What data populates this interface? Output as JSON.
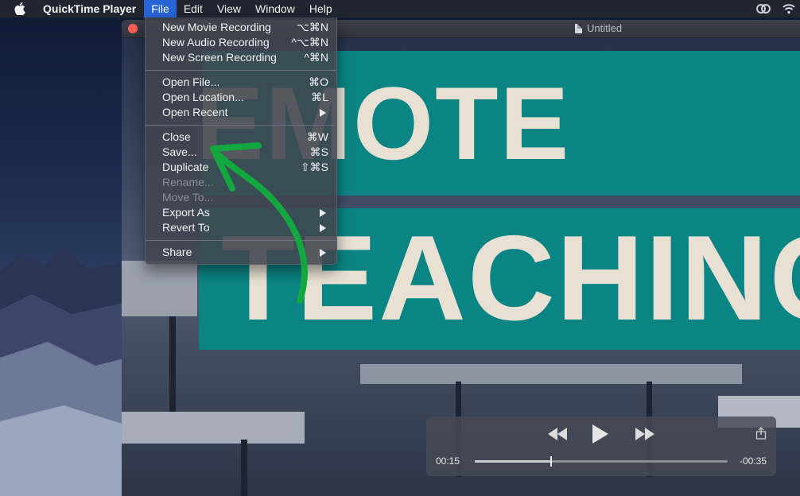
{
  "menubar": {
    "app_name": "QuickTime Player",
    "menus": [
      "File",
      "Edit",
      "View",
      "Window",
      "Help"
    ],
    "active_menu": "File"
  },
  "window": {
    "title": "Untitled"
  },
  "video": {
    "line1": "EMOTE",
    "line2": "TEACHING"
  },
  "file_menu": {
    "items": [
      {
        "label": "New Movie Recording",
        "shortcut": "⌥⌘N"
      },
      {
        "label": "New Audio Recording",
        "shortcut": "^⌥⌘N"
      },
      {
        "label": "New Screen Recording",
        "shortcut": "^⌘N"
      },
      {
        "label": "Open File...",
        "shortcut": "⌘O"
      },
      {
        "label": "Open Location...",
        "shortcut": "⌘L"
      },
      {
        "label": "Open Recent",
        "shortcut": ""
      },
      {
        "label": "Close",
        "shortcut": "⌘W"
      },
      {
        "label": "Save...",
        "shortcut": "⌘S"
      },
      {
        "label": "Duplicate",
        "shortcut": "⇧⌘S"
      },
      {
        "label": "Rename...",
        "shortcut": ""
      },
      {
        "label": "Move To...",
        "shortcut": ""
      },
      {
        "label": "Export As",
        "shortcut": ""
      },
      {
        "label": "Revert To",
        "shortcut": ""
      },
      {
        "label": "Share",
        "shortcut": ""
      }
    ]
  },
  "controls": {
    "elapsed": "00:15",
    "remaining": "-00:35",
    "progress": 0.3
  },
  "colors": {
    "banner": "#0b8584",
    "banner_text": "#e8e1d3",
    "menu_highlight": "#2864d6",
    "annotation_arrow": "#13a83f"
  }
}
